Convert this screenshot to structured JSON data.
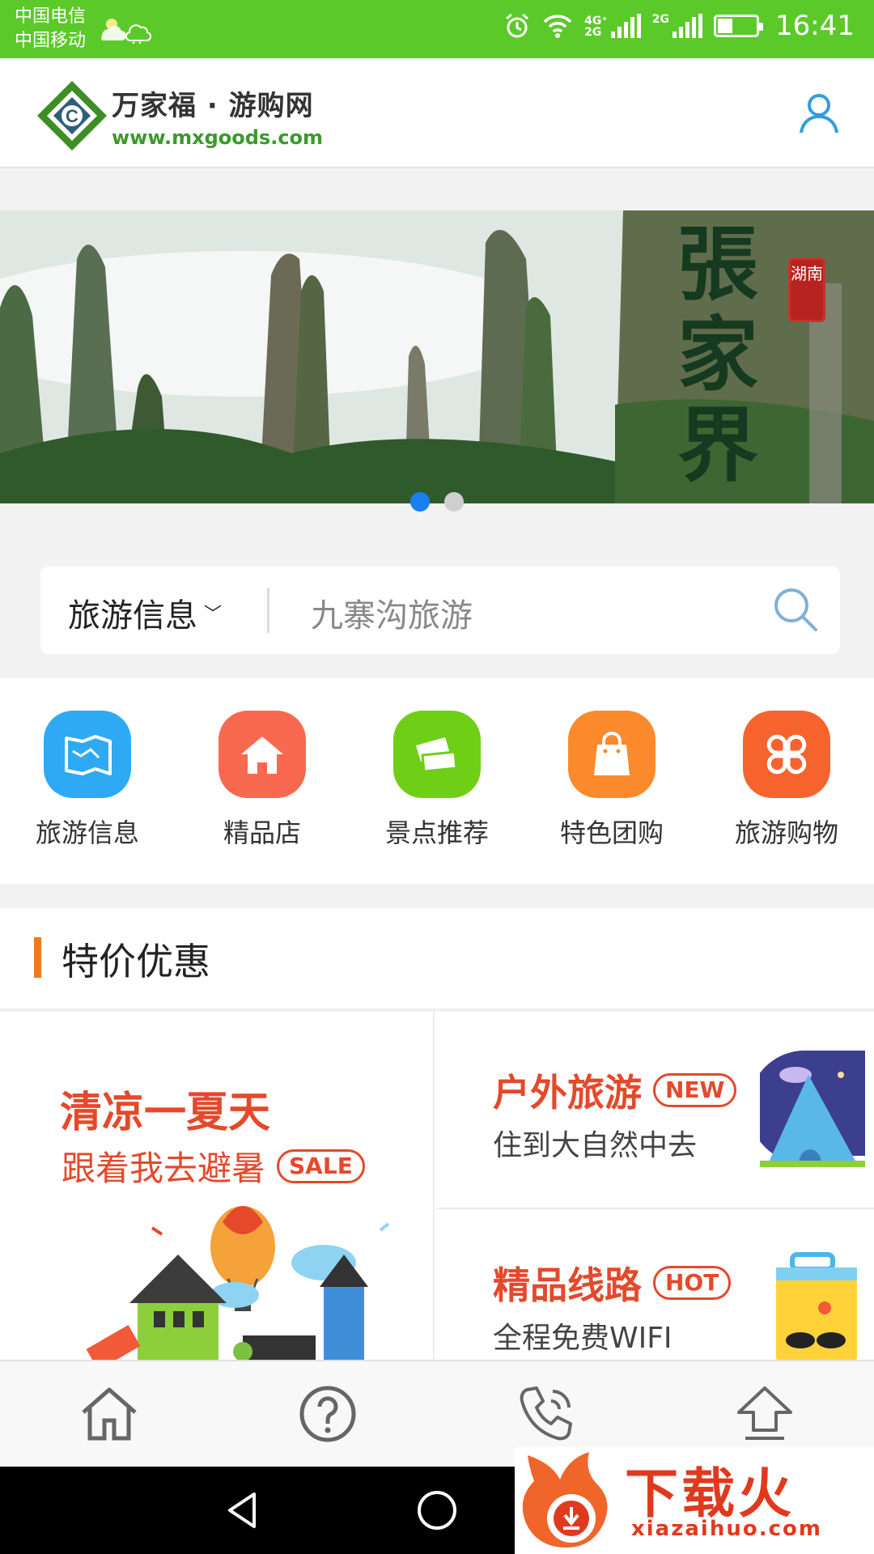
{
  "status_bar": {
    "carrier_1": "中国电信",
    "carrier_2": "中国移动",
    "network_1": "4G⁺",
    "network_1b": "2G",
    "network_2": "2G",
    "time": "16:41",
    "battery_level": 0.4,
    "icons": [
      "cloud-sun-icon",
      "cloud-rain-icon",
      "alarm-icon",
      "wifi-icon",
      "signal-icon",
      "battery-icon"
    ]
  },
  "header": {
    "logo_name": "万家福 · 游购网",
    "logo_url": "www.mxgoods.com",
    "user_icon": "user-icon"
  },
  "banner": {
    "title": "張家界",
    "seal": "湖南",
    "slides": 2,
    "active_slide": 1
  },
  "search": {
    "category": "旅游信息",
    "placeholder": "九寨沟旅游"
  },
  "nav": [
    {
      "label": "旅游信息",
      "icon": "map-icon",
      "color": "#2eaaf5"
    },
    {
      "label": "精品店",
      "icon": "house-icon",
      "color": "#f9694f"
    },
    {
      "label": "景点推荐",
      "icon": "tickets-icon",
      "color": "#6fcf17"
    },
    {
      "label": "特色团购",
      "icon": "shopping-bag-icon",
      "color": "#fb8a2c"
    },
    {
      "label": "旅游购物",
      "icon": "clover-icon",
      "color": "#f6632d"
    }
  ],
  "section": {
    "title": "特价优惠"
  },
  "promos": {
    "left": {
      "title": "清凉一夏天",
      "subtitle": "跟着我去避暑",
      "badge": "SALE"
    },
    "right_1": {
      "title": "户外旅游",
      "badge": "NEW",
      "subtitle": "住到大自然中去"
    },
    "right_2": {
      "title": "精品线路",
      "badge": "HOT",
      "subtitle": "全程免费WIFI"
    }
  },
  "bottom_bar": {
    "icons": [
      "home-icon",
      "help-icon",
      "phone-icon",
      "top-icon"
    ]
  },
  "watermark": {
    "text": "下载火",
    "url": "xiazaihuo.com"
  },
  "colors": {
    "status_green": "#5cc92a",
    "accent_blue": "#1a7ef5",
    "promo_red": "#e4492b",
    "section_bar": "#f0781e"
  }
}
